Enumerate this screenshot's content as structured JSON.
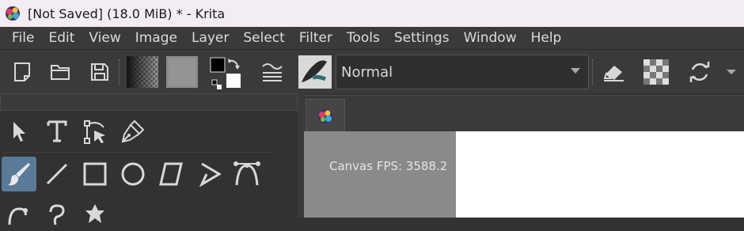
{
  "window": {
    "title": "[Not Saved]  (18.0 MiB) * - Krita"
  },
  "menu": [
    "File",
    "Edit",
    "View",
    "Image",
    "Layer",
    "Select",
    "Filter",
    "Tools",
    "Settings",
    "Window",
    "Help"
  ],
  "toolbar": {
    "blend_mode": "Normal"
  },
  "canvas": {
    "fps_label": "Canvas FPS: 3588.2"
  },
  "colors": {
    "accent_active_tool": "#5a7a9a",
    "canvas_bg": "#8a8a8a"
  }
}
